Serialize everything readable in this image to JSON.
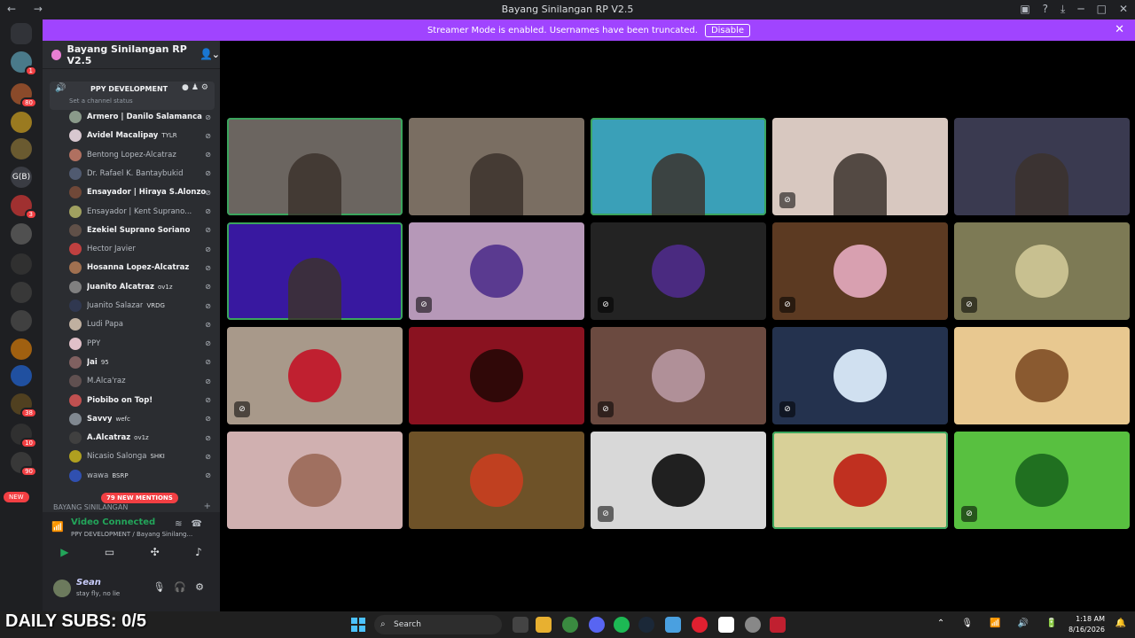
{
  "window": {
    "title": "Bayang Sinilangan RP V2.5",
    "nav_arrows": "← →",
    "icons": [
      "inbox-icon",
      "help-icon",
      "download-icon",
      "minimize-icon",
      "maximize-icon",
      "close-icon"
    ]
  },
  "banner": {
    "text": "Streamer Mode is enabled. Usernames have been truncated.",
    "button": "Disable",
    "color": "#a044ff"
  },
  "server_rail": {
    "badges": [
      "1",
      "80",
      "3",
      "38",
      "10",
      "90"
    ],
    "dm_badge": "G(B)",
    "new_label": "NEW"
  },
  "guild": {
    "name": "Bayang Sinilangan RP V2.5"
  },
  "channel": {
    "name": "PPY DEVELOPMENT",
    "status": "Set a channel status"
  },
  "members": [
    {
      "name": "Armero | Danilo Salamanca",
      "tag": "",
      "bold": true,
      "color": "#8a9a8a"
    },
    {
      "name": "Avidel Macalipay",
      "tag": "TYLR",
      "bold": true,
      "color": "#d8c8d0"
    },
    {
      "name": "Bentong Lopez-Alcatraz",
      "tag": "",
      "bold": false,
      "color": "#b07060"
    },
    {
      "name": "Dr. Rafael K. Bantaybukid",
      "tag": "",
      "bold": false,
      "color": "#505a70"
    },
    {
      "name": "Ensayador | Hiraya S.Alonzo",
      "tag": "",
      "bold": true,
      "color": "#704838"
    },
    {
      "name": "Ensayador | Kent Suprano...",
      "tag": "",
      "bold": false,
      "color": "#a0a060"
    },
    {
      "name": "Ezekiel Suprano Soriano",
      "tag": "",
      "bold": true,
      "color": "#605048"
    },
    {
      "name": "Hector Javier",
      "tag": "",
      "bold": false,
      "color": "#c04040"
    },
    {
      "name": "Hosanna Lopez-Alcatraz",
      "tag": "",
      "bold": true,
      "color": "#a07050"
    },
    {
      "name": "Juanito Alcatraz",
      "tag": "ov1z",
      "bold": true,
      "color": "#808080"
    },
    {
      "name": "Juanito Salazar",
      "tag": "VRDG",
      "bold": false,
      "color": "#303850"
    },
    {
      "name": "Ludi Papa",
      "tag": "",
      "bold": false,
      "color": "#c0b0a0"
    },
    {
      "name": "PPY",
      "tag": "",
      "bold": false,
      "color": "#e0c0c8"
    },
    {
      "name": "Jai",
      "tag": "95",
      "bold": true,
      "color": "#806060"
    },
    {
      "name": "M.Alca'raz",
      "tag": "",
      "bold": false,
      "color": "#605050"
    },
    {
      "name": "Piobibo on Top!",
      "tag": "",
      "bold": true,
      "color": "#c05050"
    },
    {
      "name": "Savvy",
      "tag": "wefc",
      "bold": true,
      "color": "#808890"
    },
    {
      "name": "A.Alcatraz",
      "tag": "ov1z",
      "bold": true,
      "color": "#404040"
    },
    {
      "name": "Nicasio Salonga",
      "tag": "SHKI",
      "bold": false,
      "color": "#b0a020"
    },
    {
      "name": "wawa",
      "tag": "BSRP",
      "bold": false,
      "color": "#3050b0"
    }
  ],
  "mentions": "79 NEW MENTIONS",
  "category": "BAYANG SINILANGAN",
  "voice": {
    "title": "Video Connected",
    "sub": "PPY DEVELOPMENT / Bayang Sinilang..."
  },
  "user": {
    "name": "Sean",
    "status": "stay fly, no lie"
  },
  "tiles": [
    {
      "bg": "#6b6560",
      "speaking": true,
      "muted": false,
      "camera": true
    },
    {
      "bg": "#7a6e62",
      "speaking": false,
      "muted": false,
      "camera": true
    },
    {
      "bg": "#3aa0b8",
      "speaking": true,
      "muted": false,
      "camera": true
    },
    {
      "bg": "#d8c8c0",
      "speaking": false,
      "muted": true,
      "camera": true
    },
    {
      "bg": "#3a3a50",
      "speaking": false,
      "muted": false,
      "camera": true
    },
    {
      "bg": "#3818a0",
      "speaking": true,
      "muted": false,
      "camera": true
    },
    {
      "bg": "#b698b8",
      "speaking": false,
      "muted": true,
      "camera": false,
      "avatar": "#5a3a90"
    },
    {
      "bg": "#232323",
      "speaking": false,
      "muted": true,
      "camera": false,
      "avatar": "#4a2a80"
    },
    {
      "bg": "#5c3a22",
      "speaking": false,
      "muted": true,
      "camera": false,
      "avatar": "#d8a0b0"
    },
    {
      "bg": "#7d7a55",
      "speaking": false,
      "muted": true,
      "camera": false,
      "avatar": "#c8c090"
    },
    {
      "bg": "#a8998a",
      "speaking": false,
      "muted": true,
      "camera": false,
      "avatar": "#c02030"
    },
    {
      "bg": "#8a1220",
      "speaking": false,
      "muted": false,
      "camera": false,
      "avatar": "#300808"
    },
    {
      "bg": "#6b4a40",
      "speaking": false,
      "muted": true,
      "camera": false,
      "avatar": "#b09098"
    },
    {
      "bg": "#24324e",
      "speaking": false,
      "muted": true,
      "camera": false,
      "avatar": "#d0e0f0"
    },
    {
      "bg": "#e8c890",
      "speaking": false,
      "muted": false,
      "camera": false,
      "avatar": "#8a5a30"
    },
    {
      "bg": "#d0b0b0",
      "speaking": false,
      "muted": false,
      "camera": false,
      "avatar": "#a07060"
    },
    {
      "bg": "#6e5228",
      "speaking": false,
      "muted": false,
      "camera": false,
      "avatar": "#c04020"
    },
    {
      "bg": "#d8d8d8",
      "speaking": false,
      "muted": true,
      "camera": false,
      "avatar": "#202020"
    },
    {
      "bg": "#d8d098",
      "speaking": true,
      "muted": false,
      "camera": false,
      "avatar": "#c03020"
    },
    {
      "bg": "#58c040",
      "speaking": false,
      "muted": true,
      "camera": false,
      "avatar": "#207020"
    }
  ],
  "overlay": {
    "subs": "DAILY SUBS: 0/5"
  },
  "taskbar": {
    "search": "Search",
    "time": "1:18 AM",
    "date": "8/16/2026"
  }
}
